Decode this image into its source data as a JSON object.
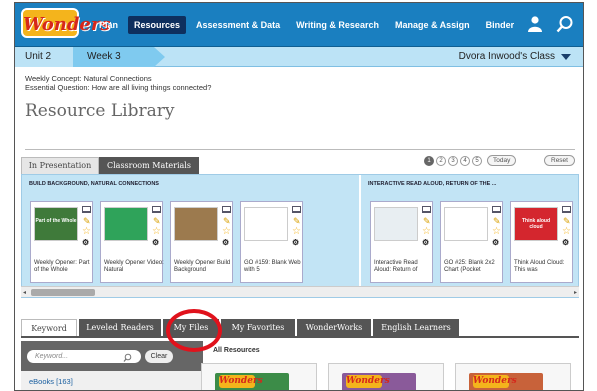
{
  "brand": {
    "logo_text": "Wonders"
  },
  "nav": {
    "items": [
      "Plan",
      "Resources",
      "Assessment & Data",
      "Writing & Research",
      "Manage & Assign",
      "Binder"
    ],
    "active": "Resources"
  },
  "subnav": {
    "unit": "Unit 2",
    "week": "Week 3",
    "class_name": "Dvora Inwood's Class"
  },
  "concept": {
    "weekly_label": "Weekly Concept:",
    "weekly_value": "Natural Connections",
    "question_label": "Essential Question:",
    "question_value": "How are all living things connected?"
  },
  "page_title": "Resource Library",
  "top_tabs": {
    "presentation": "In Presentation",
    "materials": "Classroom Materials"
  },
  "pagination": {
    "pages": [
      "1",
      "2",
      "3",
      "4",
      "5"
    ],
    "current": "1",
    "today": "Today",
    "reset": "Reset"
  },
  "groups": [
    {
      "header": "BUILD BACKGROUND, NATURAL CONNECTIONS"
    },
    {
      "header": "INTERACTIVE READ ALOUD, RETURN OF THE ..."
    }
  ],
  "cards": [
    {
      "label": "Weekly Opener: Part of the Whole",
      "thumb_color": "#3f7a3a",
      "thumb_text": "Part of the Whole"
    },
    {
      "label": "Weekly Opener Video: Natural",
      "thumb_color": "#2fa35a",
      "thumb_text": ""
    },
    {
      "label": "Weekly Opener Build Background",
      "thumb_color": "#9c7a4e",
      "thumb_text": ""
    },
    {
      "label": "GO #159: Blank Web with 5",
      "thumb_color": "#ffffff",
      "thumb_text": ""
    },
    {
      "label": "Interactive Read Aloud: Return of",
      "thumb_color": "#e8eef2",
      "thumb_text": ""
    },
    {
      "label": "GO #25: Blank 2x2 Chart (Pocket",
      "thumb_color": "#ffffff",
      "thumb_text": ""
    },
    {
      "label": "Think Aloud Cloud: This was",
      "thumb_color": "#d4262e",
      "thumb_text": "Think aloud cloud"
    }
  ],
  "bottom_tabs": [
    "Keyword",
    "Leveled Readers",
    "My Files",
    "My Favorites",
    "WonderWorks",
    "English Learners"
  ],
  "bottom_active": "Keyword",
  "highlighted_tab": "My Files",
  "search": {
    "placeholder": "Keyword...",
    "clear": "Clear"
  },
  "sidebar": {
    "first_item": "eBooks [163]"
  },
  "results": {
    "heading": "All Resources",
    "card_logo": "Wonders"
  },
  "colors": {
    "nav_bg": "#1a7fc0",
    "subnav_bg": "#bce3f6",
    "accent_red": "#e0121c",
    "brand_yellow": "#f4b41c"
  }
}
